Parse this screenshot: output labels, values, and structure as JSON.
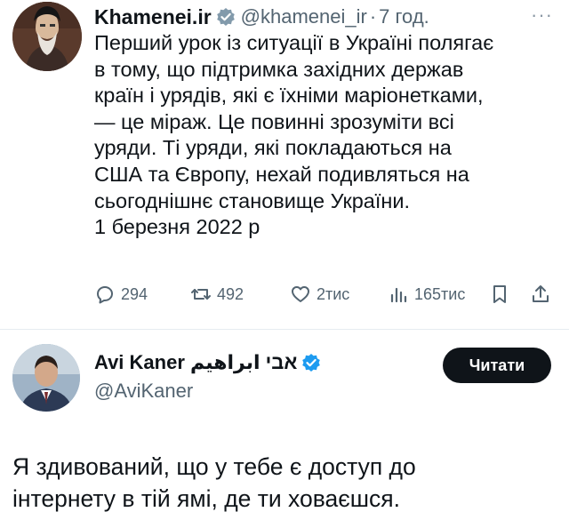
{
  "tweet": {
    "display_name": "Khamenei.ir",
    "handle": "@khamenei_ir",
    "separator": "·",
    "time": "7 год.",
    "more_label": "···",
    "body_lines": [
      "Перший урок із ситуації в Україні полягає",
      "в тому, що підтримка західних держав",
      "країн і урядів, які є їхніми маріонетками,",
      "— це міраж. Це повинні зрозуміти всі",
      "уряди. Ті уряди, які покладаються на",
      "США та Європу, нехай подивляться на",
      "сьогоднішнє становище України.",
      "1 березня 2022 р"
    ],
    "actions": {
      "replies": "294",
      "retweets": "492",
      "likes": "2тис",
      "views": "165тис"
    },
    "icons": {
      "verified": "verified-badge-icon",
      "reply": "reply-icon",
      "retweet": "retweet-icon",
      "like": "heart-icon",
      "views": "views-icon",
      "bookmark": "bookmark-icon",
      "share": "share-icon"
    }
  },
  "reply": {
    "display_name": "Avi Kaner אבי ابراهيم",
    "handle": "@AviKaner",
    "follow_label": "Читати",
    "body_lines": [
      "Я здивований, що у тебе є доступ до",
      "інтернету в тій ямі, де ти ховаєшся."
    ]
  },
  "colors": {
    "text": "#0f1419",
    "secondary": "#536471",
    "verified": "#1d9bf0",
    "button_bg": "#0f1419"
  }
}
